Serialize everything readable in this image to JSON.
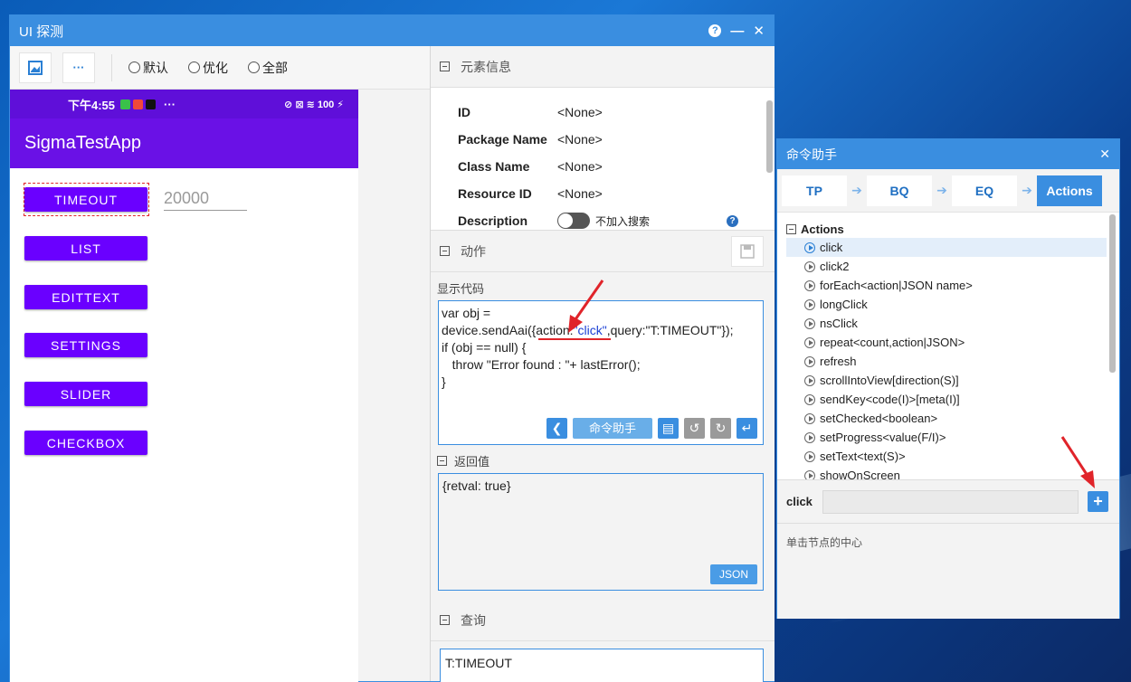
{
  "window": {
    "title": "UI 探测",
    "help": "?",
    "minimize": "—",
    "close": "✕"
  },
  "toolbar": {
    "more": "···",
    "radios": [
      "默认",
      "优化",
      "全部"
    ]
  },
  "phone": {
    "time": "下午4:55",
    "status_right": "⊘ ⊠ ≋ 100 ⚡",
    "app_title": "SigmaTestApp",
    "buttons": [
      "TIMEOUT",
      "LIST",
      "EDITTEXT",
      "SETTINGS",
      "SLIDER",
      "CHECKBOX"
    ],
    "edit_value": "20000"
  },
  "element_info": {
    "header": "元素信息",
    "rows": [
      {
        "key": "ID",
        "value": "<None>"
      },
      {
        "key": "Package Name",
        "value": "<None>"
      },
      {
        "key": "Class Name",
        "value": "<None>"
      },
      {
        "key": "Resource ID",
        "value": "<None>"
      }
    ],
    "description_key": "Description",
    "search_toggle_label": "不加入搜索"
  },
  "actions": {
    "header": "动作",
    "code_label": "显示代码",
    "code": {
      "line1": "var obj =",
      "line2_a": "device.sendAai({action:",
      "line2_b": "\"click\"",
      "line2_c": ",query:\"T:TIMEOUT\"});",
      "line3": "if (obj == null) {",
      "line4": "   throw \"Error found : \"+ lastError();",
      "line5": "}"
    },
    "helper_button": "命令助手",
    "return_label": "返回值",
    "return_value": "{retval: true}",
    "json_button": "JSON"
  },
  "query": {
    "header": "查询",
    "value": "T:TIMEOUT"
  },
  "dialog": {
    "title": "命令助手",
    "close": "✕",
    "steps": [
      "TP",
      "BQ",
      "EQ",
      "Actions"
    ],
    "tree_root": "Actions",
    "items": [
      "click",
      "click2",
      "forEach<action|JSON name>",
      "longClick",
      "nsClick",
      "repeat<count,action|JSON>",
      "refresh",
      "scrollIntoView[direction(S)]",
      "sendKey<code(I)>[meta(I)]",
      "setChecked<boolean>",
      "setProgress<value(F/I)>",
      "setText<text(S)>",
      "showOnScreen"
    ],
    "cmd_label": "click",
    "cmd_value": "",
    "plus": "+",
    "description": "单击节点的中心"
  },
  "colors": {
    "accent": "#3a8ee0",
    "android_primary": "#6a11e6",
    "annotation": "#e0242a"
  }
}
